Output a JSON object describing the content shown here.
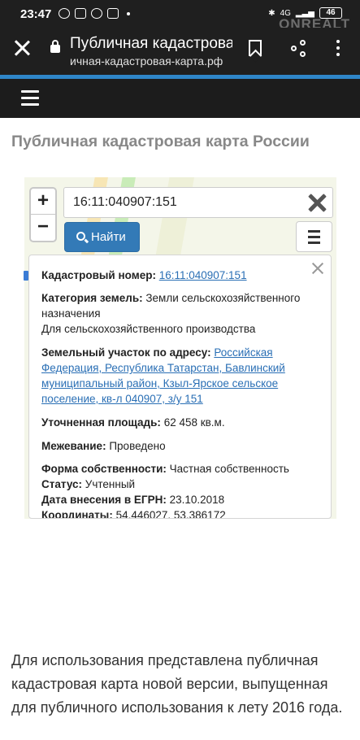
{
  "status_bar": {
    "time": "23:47",
    "network": "4G",
    "battery": "46",
    "watermark": "ONREALT"
  },
  "browser": {
    "title": "Публичная кадастровая",
    "url": "ичная-кадастровая-карта.рф"
  },
  "page": {
    "heading": "Публичная кадастровая карта России"
  },
  "map": {
    "zoom_in": "+",
    "zoom_out": "−",
    "search_value": "16:11:040907:151",
    "find_label": "Найти"
  },
  "popup": {
    "cadastral_label": "Кадастровый номер:",
    "cadastral_value": "16:11:040907:151",
    "category_label": "Категория земель:",
    "category_value": "Земли сельскохозяйственного назначения",
    "use_value": "Для сельскохозяйственного производства",
    "address_label": "Земельный участок по адресу:",
    "address_value": "Российская Федерация, Республика Татарстан, Бавлинский муниципальный район, Кзыл-Ярское сельское поселение, кв-л 040907, з/у 151",
    "area_label": "Уточненная площадь:",
    "area_value": "62 458 кв.м.",
    "survey_label": "Межевание:",
    "survey_value": "Проведено",
    "ownership_label": "Форма собственности:",
    "ownership_value": "Частная собственность",
    "status_label": "Статус:",
    "status_value": "Учтенный",
    "egrn_label": "Дата внесения в ЕГРН:",
    "egrn_value": "23.10.2018",
    "coords_label": "Координаты:",
    "coords_value": "54.446027, 53.386172"
  },
  "body_text": "Для использования представлена публичная кадастровая карта новой версии, выпущенная для публичного использования к лету 2016 года."
}
